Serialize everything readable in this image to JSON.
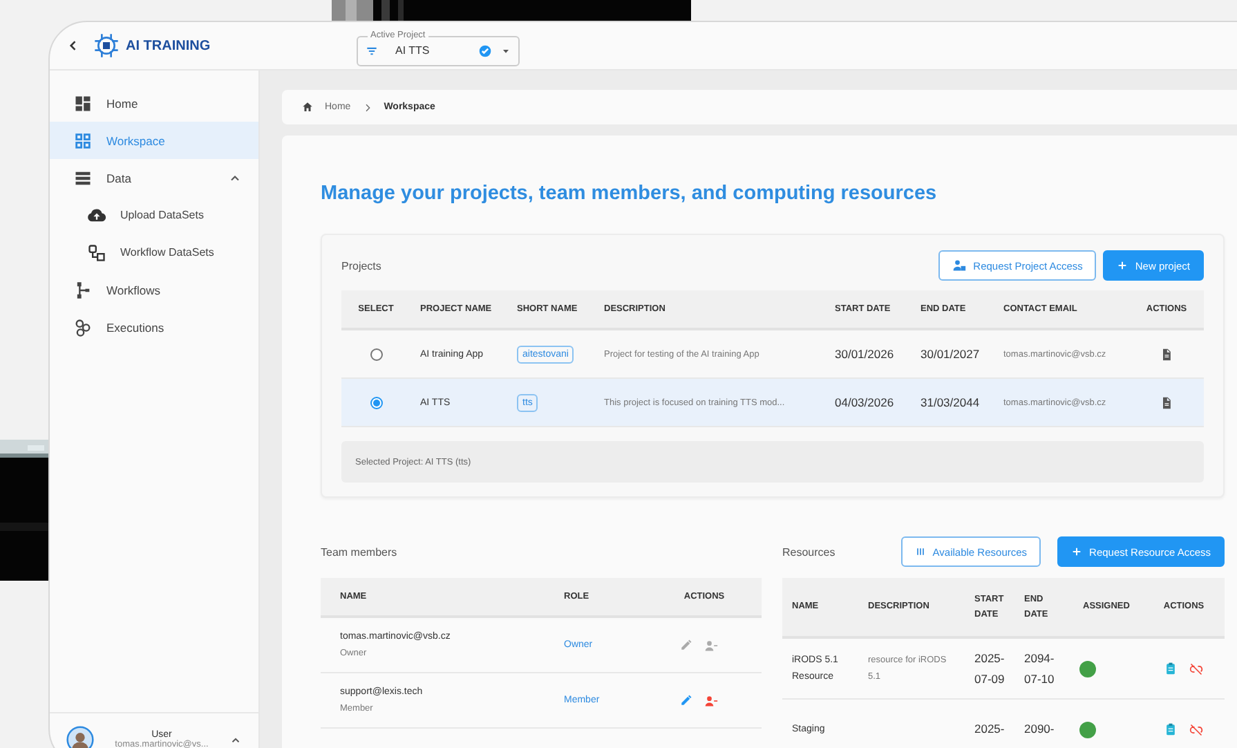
{
  "header": {
    "brand": "AI TRAINING",
    "active_project": {
      "label": "Active Project",
      "value": "AI TTS"
    }
  },
  "sidebar": {
    "items": [
      {
        "label": "Home",
        "selected": false
      },
      {
        "label": "Workspace",
        "selected": true
      },
      {
        "label": "Data",
        "selected": false,
        "expanded": true,
        "children": [
          {
            "label": "Upload DataSets",
            "selected": false
          },
          {
            "label": "Workflow DataSets",
            "selected": false
          }
        ]
      },
      {
        "label": "Workflows",
        "selected": false
      },
      {
        "label": "Executions",
        "selected": false
      }
    ],
    "user": {
      "name": "User",
      "email": "tomas.martinovic@vs..."
    }
  },
  "breadcrumb": [
    "Home",
    "Workspace"
  ],
  "title": "Manage your projects, team members, and computing resources",
  "projects": {
    "heading": "Projects",
    "buttons": [
      "Request Project Access",
      "New project"
    ],
    "columns": [
      "SELECT",
      "PROJECT NAME",
      "SHORT NAME",
      "DESCRIPTION",
      "START DATE",
      "END DATE",
      "CONTACT EMAIL",
      "ACTIONS"
    ],
    "rows": [
      {
        "selected": false,
        "name": "AI training App",
        "short_name": "aitestovani",
        "description": "Project for testing of the AI training App",
        "start": "30/01/2026",
        "end": "30/01/2027",
        "email": "tomas.martinovic@vsb.cz"
      },
      {
        "selected": true,
        "name": "AI TTS",
        "short_name": "tts",
        "description": "This project is focused on training TTS mod...",
        "start": "04/03/2026",
        "end": "31/03/2044",
        "email": "tomas.martinovic@vsb.cz"
      }
    ],
    "selection_note": "Selected Project: AI TTS (tts)"
  },
  "team": {
    "heading": "Team members",
    "columns": [
      "NAME",
      "ROLE",
      "ACTIONS"
    ],
    "rows": [
      {
        "email": "tomas.martinovic@vsb.cz",
        "subtitle": "Owner",
        "role": "Owner",
        "disabled": true
      },
      {
        "email": "support@lexis.tech",
        "subtitle": "Member",
        "role": "Member",
        "disabled": false
      }
    ]
  },
  "resources": {
    "heading": "Resources",
    "buttons": [
      "Available Resources",
      "Request Resource Access"
    ],
    "columns": [
      "NAME",
      "DESCRIPTION",
      "START DATE",
      "END DATE",
      "ASSIGNED",
      "ACTIONS"
    ],
    "rows": [
      {
        "name": "iRODS 5.1 Resource",
        "description": "resource for iRODS 5.1",
        "start": "2025-07-09",
        "end": "2094-07-10",
        "assigned": true
      },
      {
        "name": "Staging",
        "start": "2025-",
        "end": "2090-",
        "assigned": true
      }
    ]
  }
}
